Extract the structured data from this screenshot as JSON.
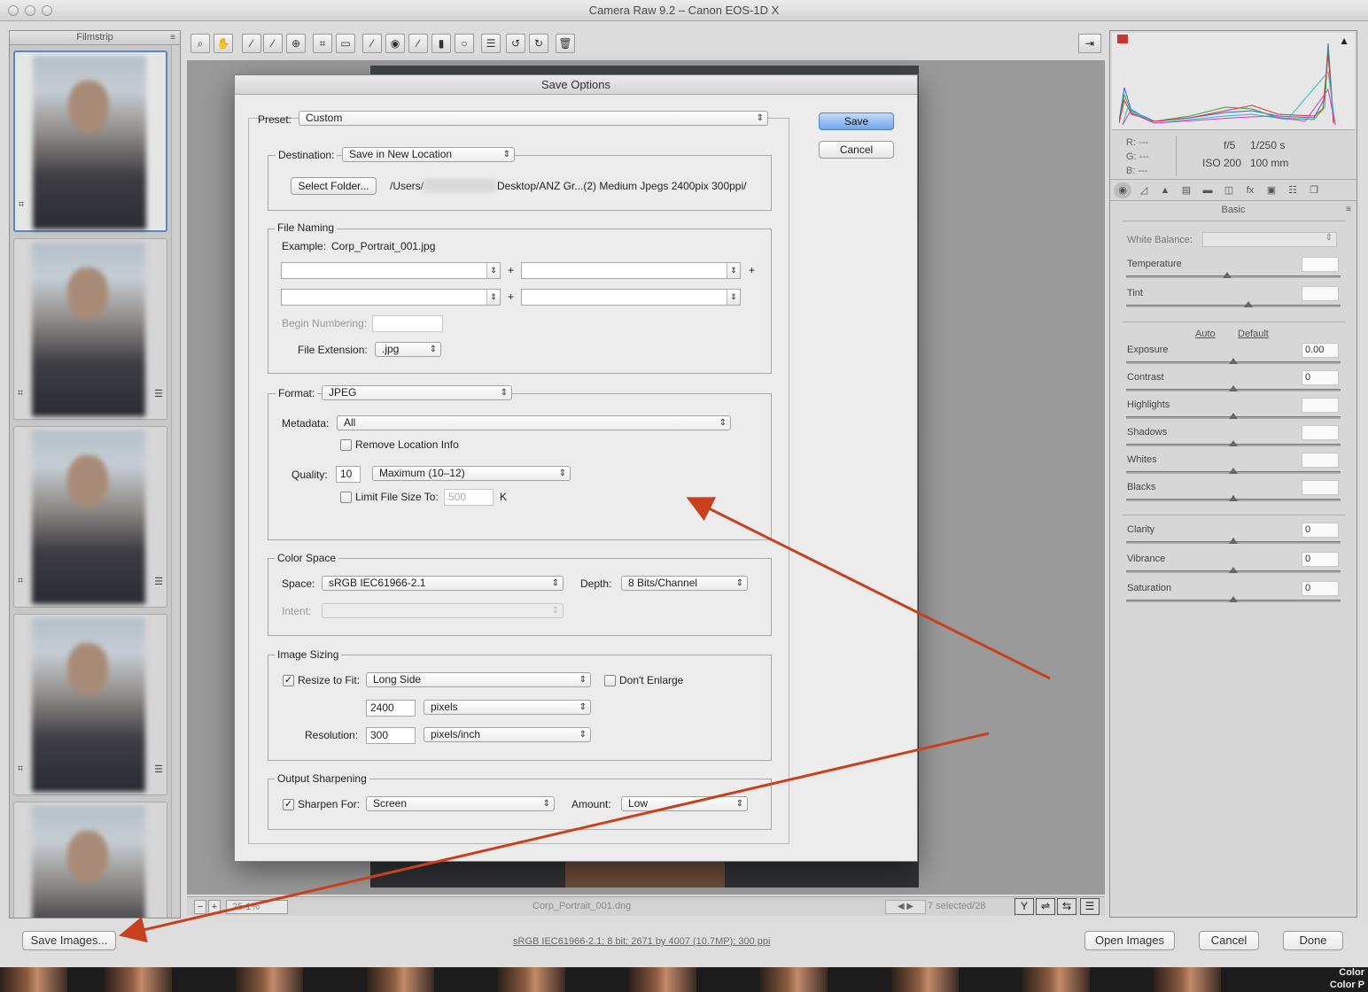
{
  "window": {
    "title": "Camera Raw 9.2  –  Canon EOS-1D X"
  },
  "filmstrip": {
    "title": "Filmstrip",
    "thumb_count": 5
  },
  "toolbar": {
    "tools": [
      "zoom-icon",
      "hand-icon",
      "white-balance-icon",
      "color-sampler-icon",
      "target-adjust-icon",
      "crop-icon",
      "straighten-icon",
      "spot-removal-icon",
      "red-eye-icon",
      "adjustment-brush-icon",
      "graduated-filter-icon",
      "radial-filter-icon",
      "preferences-icon",
      "rotate-ccw-icon",
      "rotate-cw-icon",
      "trash-icon"
    ]
  },
  "statusbar": {
    "zoom": "25.1%",
    "filename": "Corp_Portrait_001.dng",
    "selected": "7 selected/28"
  },
  "right_panel": {
    "readout": {
      "r": "R:  ---",
      "g": "G:  ---",
      "b": "B:  ---",
      "aperture": "f/5",
      "shutter": "1/250 s",
      "iso": "ISO 200",
      "focal": "100 mm"
    },
    "panel_title": "Basic",
    "white_balance_label": "White Balance:",
    "auto": "Auto",
    "default": "Default",
    "sliders": [
      {
        "label": "Temperature",
        "value": "",
        "level": 0.47
      },
      {
        "label": "Tint",
        "value": "",
        "level": 0.57
      },
      {
        "label": "Exposure",
        "value": "0.00",
        "level": 0.5
      },
      {
        "label": "Contrast",
        "value": "0",
        "level": 0.5
      },
      {
        "label": "Highlights",
        "value": "",
        "level": 0.5
      },
      {
        "label": "Shadows",
        "value": "",
        "level": 0.5
      },
      {
        "label": "Whites",
        "value": "",
        "level": 0.5
      },
      {
        "label": "Blacks",
        "value": "",
        "level": 0.5
      },
      {
        "label": "Clarity",
        "value": "0",
        "level": 0.5
      },
      {
        "label": "Vibrance",
        "value": "0",
        "level": 0.5
      },
      {
        "label": "Saturation",
        "value": "0",
        "level": 0.5
      }
    ]
  },
  "bottom_bar": {
    "save_images": "Save Images...",
    "workflow": "sRGB IEC61966-2.1; 8 bit; 2671 by 4007 (10.7MP); 300 ppi",
    "open_images": "Open Images",
    "cancel": "Cancel",
    "done": "Done",
    "dock_label_1": "Color",
    "dock_label_2": "Color P"
  },
  "dialog": {
    "title": "Save Options",
    "preset_label": "Preset:",
    "preset_value": "Custom",
    "save": "Save",
    "cancel": "Cancel",
    "destination": {
      "label": "Destination:",
      "value": "Save in New Location",
      "select_folder": "Select Folder...",
      "path_start": "/Users/",
      "path_end": "Desktop/ANZ Gr...(2) Medium Jpegs 2400pix 300ppi/"
    },
    "file_naming": {
      "title": "File Naming",
      "example_label": "Example:",
      "example_value": "Corp_Portrait_001.jpg",
      "plus": "+",
      "begin_numbering": "Begin Numbering:",
      "file_extension_label": "File Extension:",
      "file_extension_value": ".jpg"
    },
    "format": {
      "label": "Format:",
      "value": "JPEG",
      "metadata_label": "Metadata:",
      "metadata_value": "All",
      "remove_location": "Remove Location Info",
      "quality_label": "Quality:",
      "quality_value": "10",
      "quality_preset": "Maximum  (10–12)",
      "limit_size": "Limit File Size To:",
      "limit_value": "500",
      "limit_unit": "K"
    },
    "color_space": {
      "title": "Color Space",
      "space_label": "Space:",
      "space_value": "sRGB IEC61966-2.1",
      "depth_label": "Depth:",
      "depth_value": "8 Bits/Channel",
      "intent_label": "Intent:"
    },
    "image_sizing": {
      "title": "Image Sizing",
      "resize_label": "Resize to Fit:",
      "resize_value": "Long Side",
      "dont_enlarge": "Don't Enlarge",
      "size_value": "2400",
      "size_unit": "pixels",
      "resolution_label": "Resolution:",
      "resolution_value": "300",
      "resolution_unit": "pixels/inch"
    },
    "output_sharpening": {
      "title": "Output Sharpening",
      "sharpen_label": "Sharpen For:",
      "sharpen_value": "Screen",
      "amount_label": "Amount:",
      "amount_value": "Low"
    },
    "checkmark": "✓"
  },
  "colors": {
    "annotation_arrow": "#c8401e",
    "default_button": "#6fa5ea"
  }
}
